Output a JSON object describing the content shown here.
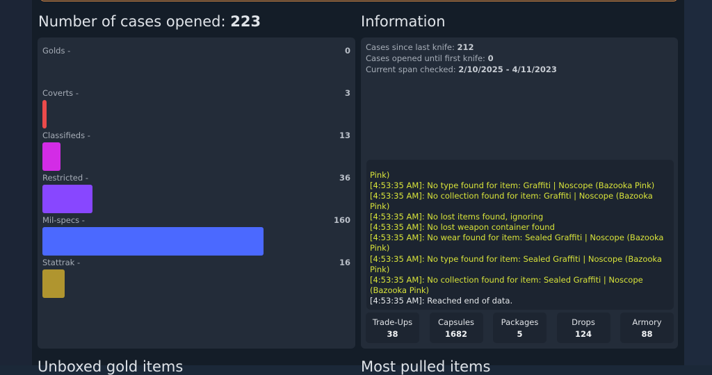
{
  "rarity_section": {
    "title_prefix": "Number of cases opened: ",
    "total_cases": "223",
    "rows": [
      {
        "label": "Golds -",
        "count": "0",
        "value": 0,
        "color": "#e4ae39"
      },
      {
        "label": "Coverts -",
        "count": "3",
        "value": 3,
        "color": "#eb4b4b"
      },
      {
        "label": "Classifieds -",
        "count": "13",
        "value": 13,
        "color": "#d32ce6"
      },
      {
        "label": "Restricted -",
        "count": "36",
        "value": 36,
        "color": "#8847ff"
      },
      {
        "label": "Mil-specs -",
        "count": "160",
        "value": 160,
        "color": "#4b69ff"
      },
      {
        "label": "Stattrak -",
        "count": "16",
        "value": 16,
        "color": "#b0952f"
      }
    ],
    "max_value": 223
  },
  "information": {
    "title": "Information",
    "lines": [
      {
        "label": "Cases since last knife: ",
        "value": "212"
      },
      {
        "label": "Cases opened until first knife: ",
        "value": "0"
      },
      {
        "label": "Current span checked: ",
        "value": "2/10/2025 - 4/11/2023"
      }
    ],
    "log": [
      {
        "text": "Pink)",
        "type": "warn"
      },
      {
        "text": "[4:53:35 AM]: No type found for item: Graffiti | Noscope (Bazooka Pink)",
        "type": "warn"
      },
      {
        "text": "[4:53:35 AM]: No collection found for item: Graffiti | Noscope (Bazooka Pink)",
        "type": "warn"
      },
      {
        "text": "[4:53:35 AM]: No lost items found, ignoring",
        "type": "warn"
      },
      {
        "text": "[4:53:35 AM]: No lost weapon container found",
        "type": "warn"
      },
      {
        "text": "[4:53:35 AM]: No wear found for item: Sealed Graffiti | Noscope (Bazooka Pink)",
        "type": "warn"
      },
      {
        "text": "[4:53:35 AM]: No type found for item: Sealed Graffiti | Noscope (Bazooka Pink)",
        "type": "warn"
      },
      {
        "text": "[4:53:35 AM]: No collection found for item: Sealed Graffiti | Noscope (Bazooka Pink)",
        "type": "warn"
      },
      {
        "text": "[4:53:35 AM]: Reached end of data.",
        "type": "plain"
      }
    ],
    "stats": [
      {
        "label": "Trade-Ups",
        "value": "38"
      },
      {
        "label": "Capsules",
        "value": "1682"
      },
      {
        "label": "Packages",
        "value": "5"
      },
      {
        "label": "Drops",
        "value": "124"
      },
      {
        "label": "Armory",
        "value": "88"
      }
    ]
  },
  "bottom_sections": {
    "left_title": "Unboxed gold items",
    "right_title": "Most pulled items"
  }
}
